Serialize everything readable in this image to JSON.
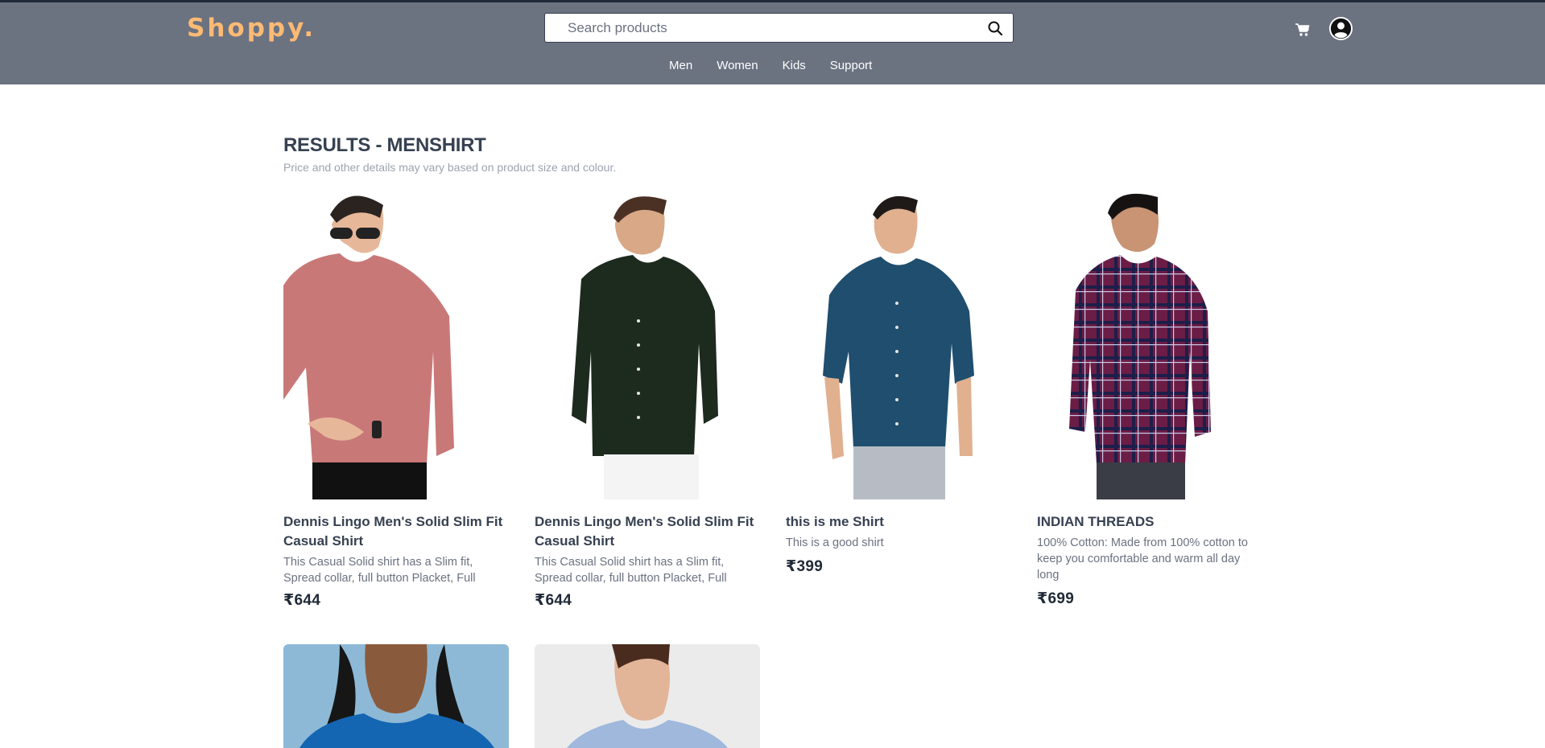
{
  "brand": {
    "logo": "Shoppy."
  },
  "search": {
    "placeholder": "Search products"
  },
  "nav": {
    "items": [
      "Men",
      "Women",
      "Kids",
      "Support"
    ]
  },
  "results": {
    "title": "RESULTS - MENSHIRT",
    "subtitle": "Price and other details may vary based on product size and colour."
  },
  "products": [
    {
      "title": "Dennis Lingo Men's Solid Slim Fit Casual Shirt",
      "description": "This Casual Solid shirt has a Slim fit, Spread collar, full button Placket, Full",
      "price": "₹644",
      "shirt_color": "#c97878"
    },
    {
      "title": "Dennis Lingo Men's Solid Slim Fit Casual Shirt",
      "description": "This Casual Solid shirt has a Slim fit, Spread collar, full button Placket, Full",
      "price": "₹644",
      "shirt_color": "#1d2a1e"
    },
    {
      "title": "this is me Shirt",
      "description": "This is a good shirt",
      "price": "₹399",
      "shirt_color": "#1f4e6e"
    },
    {
      "title": "INDIAN THREADS",
      "description": "100% Cotton: Made from 100% cotton to keep you comfortable and warm all day long",
      "price": "₹699",
      "shirt_color": "#6b1d45"
    },
    {
      "shirt_color": "#1466b3",
      "background": "#8db9d6"
    },
    {
      "shirt_color": "#9fb8dc",
      "background": "#ebebeb"
    }
  ],
  "colors": {
    "header_bg": "#6b7280",
    "logo": "#fdba74",
    "text_dark": "#374151",
    "text_muted": "#6b7280"
  }
}
